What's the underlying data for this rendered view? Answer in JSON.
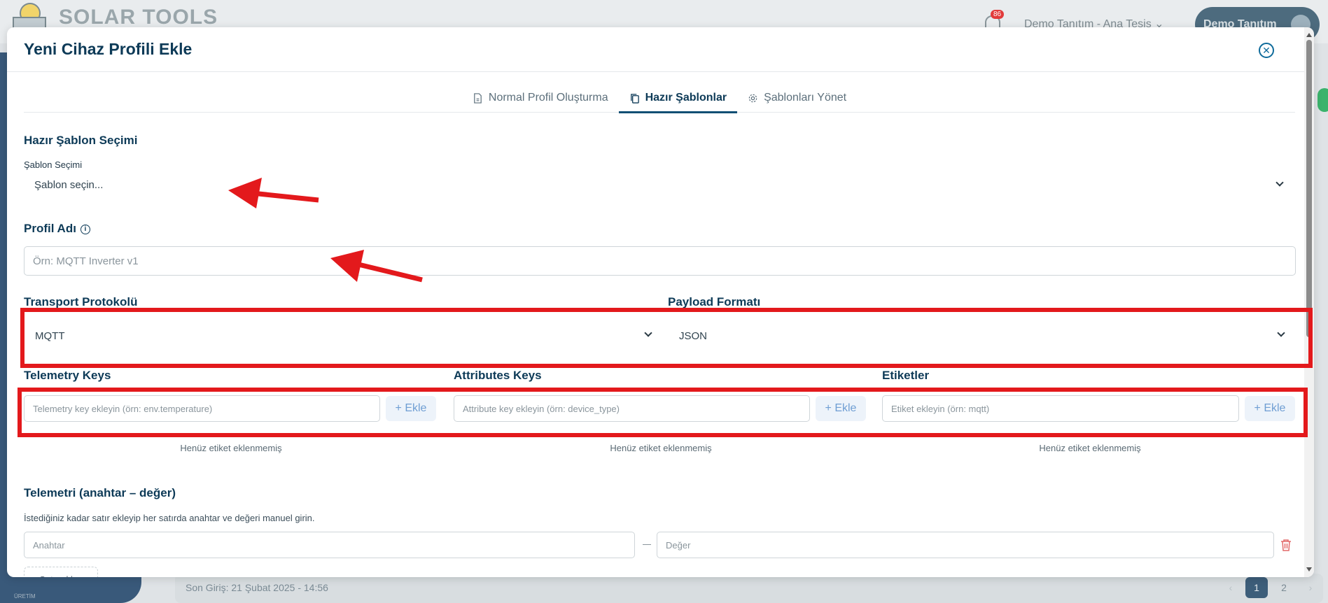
{
  "background": {
    "logo_text": "SOLAR TOOLS",
    "notification_count": "86",
    "tenant_label": "Demo Tanıtım - Ana Tesis",
    "user_label": "Demo Tanıtım",
    "last_login": "Son Giriş: 21 Şubat 2025 - 14:56",
    "pagination": {
      "prev": "‹",
      "pages": [
        "1",
        "2"
      ],
      "next": "›"
    },
    "sidebar_footer": "ÜRETİM"
  },
  "modal": {
    "title": "Yeni Cihaz Profili Ekle",
    "tabs": [
      {
        "label": "Normal Profil Oluşturma",
        "icon": "file-icon"
      },
      {
        "label": "Hazır Şablonlar",
        "icon": "copy-icon"
      },
      {
        "label": "Şablonları Yönet",
        "icon": "gear-icon"
      }
    ],
    "template_section": {
      "title": "Hazır Şablon Seçimi",
      "select_label": "Şablon Seçimi",
      "select_value": "Şablon seçin..."
    },
    "profile_name": {
      "label": "Profil Adı",
      "placeholder": "Örn: MQTT Inverter v1"
    },
    "transport": {
      "label": "Transport Protokolü",
      "value": "MQTT"
    },
    "payload": {
      "label": "Payload Formatı",
      "value": "JSON"
    },
    "telemetry_keys": {
      "label": "Telemetry Keys",
      "placeholder": "Telemetry key ekleyin (örn: env.temperature)",
      "add_label": "+ Ekle",
      "empty": "Henüz etiket eklenmemiş"
    },
    "attributes_keys": {
      "label": "Attributes Keys",
      "placeholder": "Attribute key ekleyin (örn: device_type)",
      "add_label": "+ Ekle",
      "empty": "Henüz etiket eklenmemiş"
    },
    "tags": {
      "label": "Etiketler",
      "placeholder": "Etiket ekleyin (örn: mqtt)",
      "add_label": "+ Ekle",
      "empty": "Henüz etiket eklenmemiş"
    },
    "telemetry_kv": {
      "title": "Telemetri (anahtar – değer)",
      "description": "İstediğiniz kadar satır ekleyip her satırda anahtar ve değeri manuel girin.",
      "key_placeholder": "Anahtar",
      "value_placeholder": "Değer",
      "add_row_label": "+ Satır ekle"
    }
  },
  "colors": {
    "primary": "#0d3a57",
    "annotation_red": "#e3191c",
    "add_button_text": "#6f9ed3"
  }
}
